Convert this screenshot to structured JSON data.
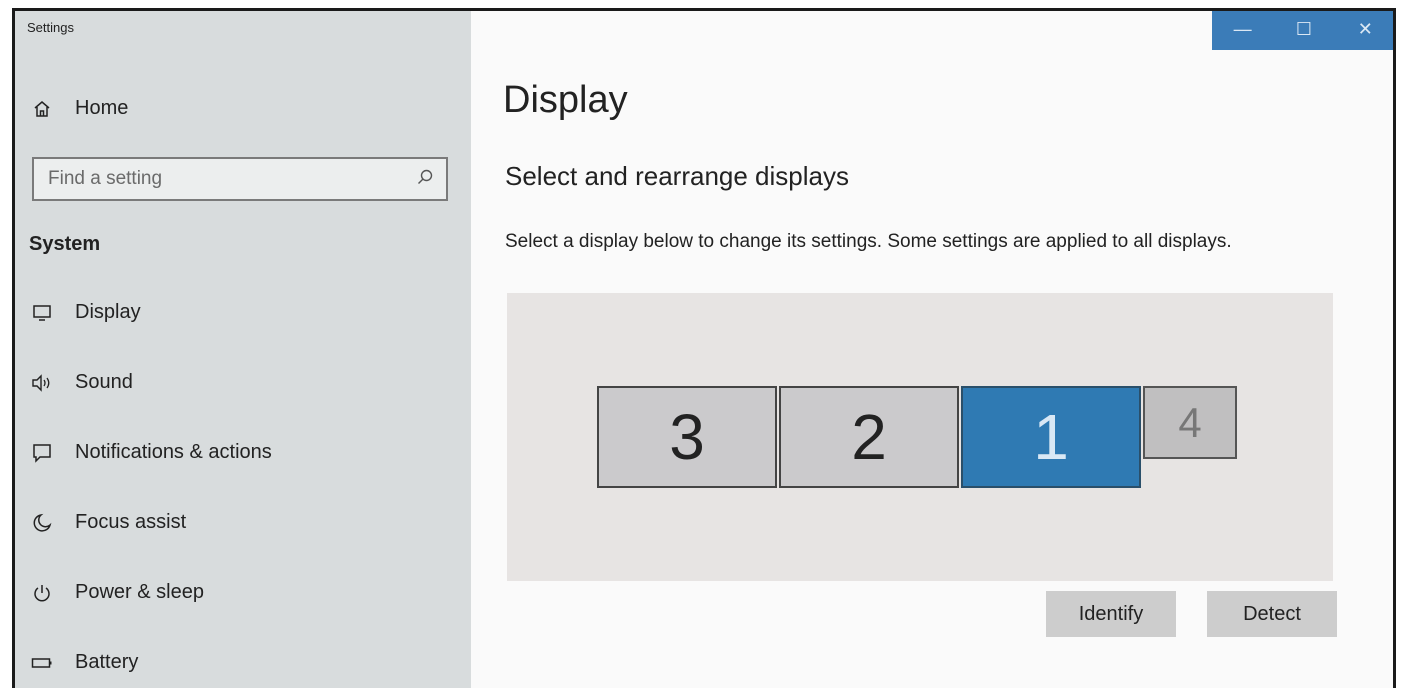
{
  "app": {
    "title": "Settings"
  },
  "sidebar": {
    "home_label": "Home",
    "search_placeholder": "Find a setting",
    "section_label": "System",
    "items": [
      {
        "label": "Display",
        "icon": "monitor-icon"
      },
      {
        "label": "Sound",
        "icon": "speaker-icon"
      },
      {
        "label": "Notifications & actions",
        "icon": "notification-icon"
      },
      {
        "label": "Focus assist",
        "icon": "moon-icon"
      },
      {
        "label": "Power & sleep",
        "icon": "power-icon"
      },
      {
        "label": "Battery",
        "icon": "battery-icon"
      }
    ]
  },
  "titlebar": {
    "minimize": "—",
    "maximize": "☐",
    "close": "✕"
  },
  "main": {
    "title": "Display",
    "section_title": "Select and rearrange displays",
    "description": "Select a display below to change its settings. Some settings are applied to all displays.",
    "monitors": [
      {
        "label": "3",
        "selected": false
      },
      {
        "label": "2",
        "selected": false
      },
      {
        "label": "1",
        "selected": true
      },
      {
        "label": "4",
        "selected": false
      }
    ],
    "identify_label": "Identify",
    "detect_label": "Detect"
  },
  "colors": {
    "accent": "#2f7ab3",
    "sidebar_bg": "#d8dcdd",
    "arrange_bg": "#e7e4e3"
  }
}
